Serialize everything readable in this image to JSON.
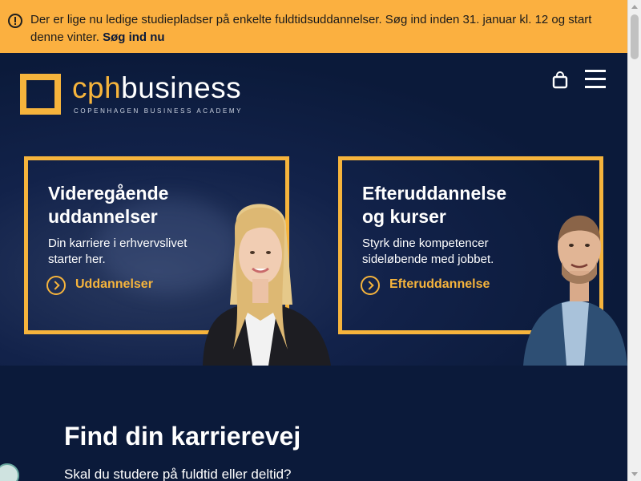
{
  "banner": {
    "icon": "alert-circle-icon",
    "text": "Der er lige nu ledige studiepladser på enkelte fuldtidsuddannelser. Søg ind inden 31. januar kl. 12 og start denne vinter.",
    "link": "Søg ind nu",
    "background": "#fbb040"
  },
  "header": {
    "logo_prefix": "cph",
    "logo_suffix": "business",
    "logo_tagline": "COPENHAGEN BUSINESS ACADEMY",
    "cart_icon": "shopping-bag-icon",
    "menu_icon": "hamburger-menu-icon"
  },
  "cards": [
    {
      "title": "Videregående uddannelser",
      "description": "Din karriere i erhvervslivet starter her.",
      "link": "Uddannelser"
    },
    {
      "title": "Efteruddannelse og kurser",
      "description": "Styrk dine kompetencer sideløbende med jobbet.",
      "link": "Efteruddannelse"
    }
  ],
  "section": {
    "title": "Find din karrierevej",
    "subtitle": "Skal du studere på fuldtid eller deltid?"
  },
  "colors": {
    "accent": "#f6b43c",
    "navy": "#0b1a3a",
    "text_light": "#ffffff"
  }
}
